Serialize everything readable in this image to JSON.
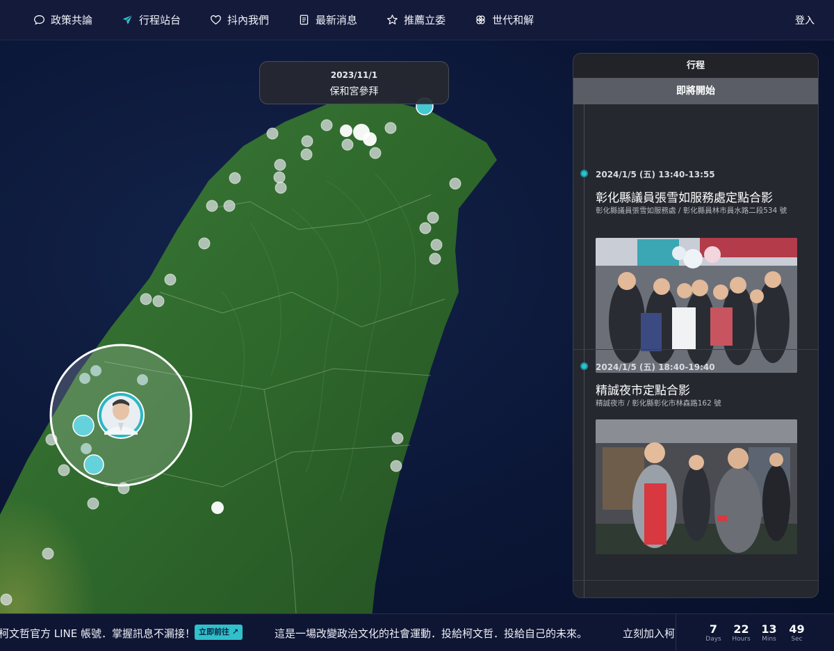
{
  "nav": {
    "items": [
      {
        "label": "政策共論",
        "icon": "chat-bubble-icon"
      },
      {
        "label": "行程站台",
        "icon": "paper-plane-icon"
      },
      {
        "label": "抖內我們",
        "icon": "heart-icon"
      },
      {
        "label": "最新消息",
        "icon": "document-icon"
      },
      {
        "label": "推薦立委",
        "icon": "star-icon"
      },
      {
        "label": "世代和解",
        "icon": "interlock-icon"
      }
    ],
    "login": "登入"
  },
  "tooltip": {
    "date": "2023/11/1",
    "title": "保和宮參拜"
  },
  "panel": {
    "header": "行程",
    "subheader": "即將開始",
    "events": [
      {
        "time": "2024/1/5 (五) 13:40-13:55",
        "title": "彰化縣議員張雪如服務處定點合影",
        "place": "彰化縣議員張雪如服務處 / 彰化縣員林市員水路二段534 號"
      },
      {
        "time": "2024/1/5 (五) 18:40-19:40",
        "title": "精誠夜市定點合影",
        "place": "精誠夜市 / 彰化縣彰化市林森路162 號"
      }
    ]
  },
  "bottom": {
    "line_text": "柯文哲官方 LINE 帳號．掌握訊息不漏接！",
    "goto_label": "立即前往 ↗",
    "slogan": "這是一場改變政治文化的社會運動．投給柯文哲．投給自己的未來。",
    "join": "立刻加入柯"
  },
  "countdown": [
    {
      "value": "7",
      "unit": "Days"
    },
    {
      "value": "22",
      "unit": "Hours"
    },
    {
      "value": "13",
      "unit": "Mins"
    },
    {
      "value": "49",
      "unit": "Sec"
    }
  ],
  "colors": {
    "accent": "#2fc0ca",
    "nav_bg": "#141a3a",
    "panel_bg": "#25282f"
  }
}
